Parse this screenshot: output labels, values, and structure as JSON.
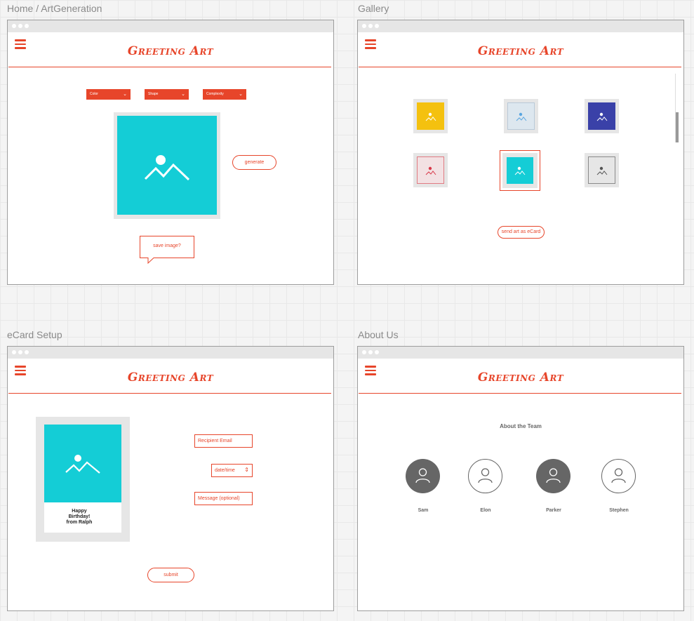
{
  "frames": {
    "art_generation": {
      "title": "Home / ArtGeneration"
    },
    "gallery": {
      "title": "Gallery"
    },
    "ecard_setup": {
      "title": "eCard Setup"
    },
    "about_us": {
      "title": "About Us"
    }
  },
  "brand": {
    "logo_text": "Greeting Art",
    "accent_color": "#e7452a"
  },
  "art_generation": {
    "dropdowns": [
      {
        "label": "Color"
      },
      {
        "label": "Shape"
      },
      {
        "label": "Complexity"
      }
    ],
    "preview_color": "#14cdd6",
    "generate_label": "generate",
    "save_label": "save image?"
  },
  "gallery": {
    "thumbnails": [
      {
        "color": "#f4c10f",
        "icon": "image-icon"
      },
      {
        "color": "#dde7ef",
        "icon": "image-icon"
      },
      {
        "color": "#3a41a8",
        "icon": "image-icon"
      },
      {
        "color": "#f3e1e3",
        "icon": "image-icon"
      },
      {
        "color": "#14cdd6",
        "icon": "image-icon",
        "selected": true
      },
      {
        "color": "#e6e6e6",
        "icon": "image-icon"
      }
    ],
    "send_label": "send art as eCard"
  },
  "ecard": {
    "card_message_lines": [
      "Happy",
      "Birthday!",
      "from Ralph"
    ],
    "recipient_email_placeholder": "Recipient Email",
    "datetime_label": "date/time",
    "message_placeholder": "Message (optional)",
    "submit_label": "submit"
  },
  "about": {
    "heading": "About the Team",
    "members": [
      {
        "name": "Sam",
        "style": "filled"
      },
      {
        "name": "Elon",
        "style": "outline"
      },
      {
        "name": "Parker",
        "style": "filled"
      },
      {
        "name": "Stephen",
        "style": "outline"
      }
    ]
  }
}
